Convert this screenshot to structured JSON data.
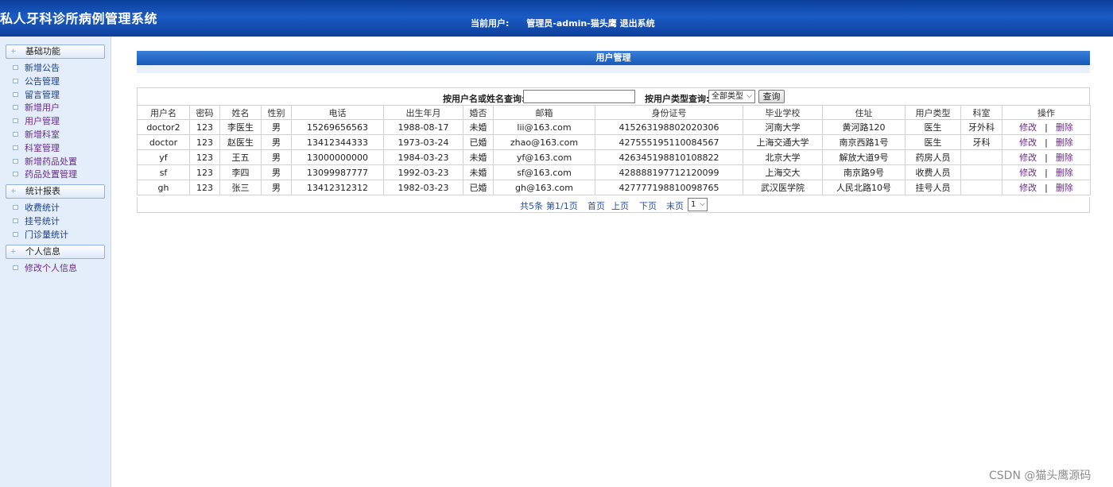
{
  "header": {
    "title": "私人牙科诊所病例管理系统",
    "current_user_label": "当前用户:",
    "current_user": "管理员-admin-猫头鹰",
    "logout": "退出系统"
  },
  "sidebar": {
    "groups": [
      {
        "title": "基础功能",
        "items": [
          "新增公告",
          "公告管理",
          "留言管理",
          "新增用户",
          "用户管理",
          "新增科室",
          "科室管理",
          "新增药品处置",
          "药品处置管理"
        ]
      },
      {
        "title": "统计报表",
        "items": [
          "收费统计",
          "挂号统计",
          "门诊量统计"
        ]
      },
      {
        "title": "个人信息",
        "items": [
          "修改个人信息"
        ]
      }
    ]
  },
  "panel": {
    "title": "用户管理"
  },
  "search": {
    "name_label": "按用户名或姓名查询:",
    "name_value": "",
    "type_label": "按用户类型查询:",
    "type_selected": "全部类型",
    "button": "查询"
  },
  "table": {
    "columns": [
      "用户名",
      "密码",
      "姓名",
      "性别",
      "电话",
      "出生年月",
      "婚否",
      "邮箱",
      "身份证号",
      "毕业学校",
      "住址",
      "用户类型",
      "科室",
      "操作"
    ],
    "rows": [
      [
        "doctor2",
        "123",
        "李医生",
        "男",
        "15269656563",
        "1988-08-17",
        "未婚",
        "lii@163.com",
        "415263198802020306",
        "河南大学",
        "黄河路120",
        "医生",
        "牙外科"
      ],
      [
        "doctor",
        "123",
        "赵医生",
        "男",
        "13412344333",
        "1973-03-24",
        "已婚",
        "zhao@163.com",
        "427555195110084567",
        "上海交通大学",
        "南京西路1号",
        "医生",
        "牙科"
      ],
      [
        "yf",
        "123",
        "王五",
        "男",
        "13000000000",
        "1984-03-23",
        "未婚",
        "yf@163.com",
        "426345198810108822",
        "北京大学",
        "解放大道9号",
        "药房人员",
        ""
      ],
      [
        "sf",
        "123",
        "李四",
        "男",
        "13099987777",
        "1992-03-23",
        "未婚",
        "sf@163.com",
        "428888197712120099",
        "上海交大",
        "南京路9号",
        "收费人员",
        ""
      ],
      [
        "gh",
        "123",
        "张三",
        "男",
        "13412312312",
        "1982-03-23",
        "已婚",
        "gh@163.com",
        "427777198810098765",
        "武汉医学院",
        "人民北路10号",
        "挂号人员",
        ""
      ]
    ],
    "action_edit": "修改",
    "action_sep": "|",
    "action_delete": "删除"
  },
  "pager": {
    "total": "共5条",
    "page_info": "第1/1页",
    "first": "首页",
    "prev": "上页",
    "next": "下页",
    "last": "末页",
    "page_selected": "1"
  },
  "watermark": "CSDN @猫头鹰源码"
}
